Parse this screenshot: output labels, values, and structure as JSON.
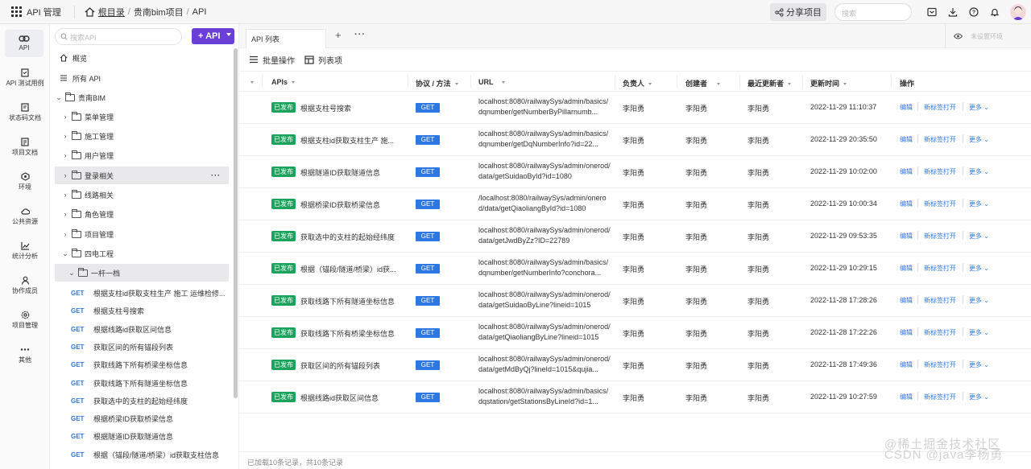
{
  "topbar": {
    "app_label": "API 管理",
    "breadcrumb": {
      "root": "根目录",
      "sep1": "/",
      "project": "贵南bim项目",
      "sep2": "/",
      "current": "API"
    },
    "share_label": "分享项目",
    "search_placeholder": "搜索"
  },
  "left_nav": [
    {
      "label": "API",
      "icon": "link-icon"
    },
    {
      "label": "API 测试用例",
      "icon": "test-case-icon"
    },
    {
      "label": "状态码文档",
      "icon": "status-doc-icon"
    },
    {
      "label": "项目文档",
      "icon": "doc-icon"
    },
    {
      "label": "环境",
      "icon": "environment-icon"
    },
    {
      "label": "公共资源",
      "icon": "resource-icon"
    },
    {
      "label": "统计分析",
      "icon": "chart-icon"
    },
    {
      "label": "协作成员",
      "icon": "members-icon"
    },
    {
      "label": "项目管理",
      "icon": "settings-icon"
    },
    {
      "label": "其他",
      "icon": "more-icon"
    }
  ],
  "tree": {
    "search_placeholder": "搜索API",
    "add_label": "+ API",
    "overview": "概览",
    "all_api": "所有 API",
    "root_folder": "贵南BIM",
    "folders": [
      "菜单管理",
      "施工管理",
      "用户管理",
      "登录相关",
      "线路相关",
      "角色管理",
      "项目管理",
      "四电工程"
    ],
    "subfolder": "一杆一档",
    "items": [
      {
        "method": "GET",
        "name": "根据支柱id获取支柱生产 施工 运维检修..."
      },
      {
        "method": "GET",
        "name": "根据支柱号搜索"
      },
      {
        "method": "GET",
        "name": "根据线路id获取区间信息"
      },
      {
        "method": "GET",
        "name": "获取区间的所有锚段列表"
      },
      {
        "method": "GET",
        "name": "获取线路下所有桥梁坐标信息"
      },
      {
        "method": "GET",
        "name": "获取线路下所有隧道坐标信息"
      },
      {
        "method": "GET",
        "name": "获取选中的支柱的起始经纬度"
      },
      {
        "method": "GET",
        "name": "根据桥梁ID获取桥梁信息"
      },
      {
        "method": "GET",
        "name": "根据隧道ID获取隧道信息"
      },
      {
        "method": "GET",
        "name": "根据（锚段/隧道/桥梁）id获取支柱信息"
      }
    ]
  },
  "main": {
    "tab_label": "API 列表",
    "tab_add": "+",
    "tab_more": "···",
    "env_label": "未设置环境",
    "toolbar": {
      "batch": "批量操作",
      "columns": "列表项"
    },
    "columns": {
      "apis": "APIs",
      "protocol": "协议 / 方法",
      "url": "URL",
      "owner": "负责人",
      "creator": "创建者",
      "updater": "最近更新者",
      "updated": "更新时间",
      "actions": "操作"
    },
    "action_labels": {
      "edit": "编辑",
      "new_tab": "新标签打开",
      "more": "更多"
    },
    "rows": [
      {
        "status": "已发布",
        "name": "根据支柱号搜索",
        "method": "GET",
        "url": "localhost:8080/railwaySys/admin/basics/dqnumber/getNumberByPillarnumb...",
        "owner": "李阳勇",
        "creator": "李阳勇",
        "updater": "李阳勇",
        "updated": "2022-11-29 11:10:37"
      },
      {
        "status": "已发布",
        "name": "根据支柱id获取支柱生产 施...",
        "method": "GET",
        "url": "localhost:8080/railwaySys/admin/basics/dqnumber/getDqNumberInfo?id=22...",
        "owner": "李阳勇",
        "creator": "李阳勇",
        "updater": "李阳勇",
        "updated": "2022-11-29 20:35:50"
      },
      {
        "status": "已发布",
        "name": "根据隧道ID获取隧道信息",
        "method": "GET",
        "url": "localhost:8080/railwaySys/admin/onerod/data/getSuidaoById?id=1080",
        "owner": "李阳勇",
        "creator": "李阳勇",
        "updater": "李阳勇",
        "updated": "2022-11-29 10:02:00"
      },
      {
        "status": "已发布",
        "name": "根据桥梁ID获取桥梁信息",
        "method": "GET",
        "url": "/localhost:8080/railwaySys/admin/onerod/data/getQiaoliangById?id=1080",
        "owner": "李阳勇",
        "creator": "李阳勇",
        "updater": "李阳勇",
        "updated": "2022-11-29 10:00:34"
      },
      {
        "status": "已发布",
        "name": "获取选中的支柱的起始经纬度",
        "method": "GET",
        "url": "localhost:8080/railwaySys/admin/onerod/data/getJwdByZz?ID=22789",
        "owner": "李阳勇",
        "creator": "李阳勇",
        "updater": "李阳勇",
        "updated": "2022-11-29 09:53:35"
      },
      {
        "status": "已发布",
        "name": "根据（锚段/隧道/桥梁）id获...",
        "method": "GET",
        "url": "localhost:8080/railwaySys/admin/basics/dqnumber/getNumberInfo?conchora...",
        "owner": "李阳勇",
        "creator": "李阳勇",
        "updater": "李阳勇",
        "updated": "2022-11-29 10:29:15"
      },
      {
        "status": "已发布",
        "name": "获取线路下所有隧道坐标信息",
        "method": "GET",
        "url": "localhost:8080/railwaySys/admin/onerod/data/getSuidaoByLine?lineid=1015",
        "owner": "李阳勇",
        "creator": "李阳勇",
        "updater": "李阳勇",
        "updated": "2022-11-28 17:28:26"
      },
      {
        "status": "已发布",
        "name": "获取线路下所有桥梁坐标信息",
        "method": "GET",
        "url": "localhost:8080/railwaySys/admin/onerod/data/getQiaoliangByLine?lineid=1015",
        "owner": "李阳勇",
        "creator": "李阳勇",
        "updater": "李阳勇",
        "updated": "2022-11-28 17:22:26"
      },
      {
        "status": "已发布",
        "name": "获取区间的所有锚段列表",
        "method": "GET",
        "url": "localhost:8080/railwaySys/admin/onerod/data/getMdByQj?lineId=1015&qujia...",
        "owner": "李阳勇",
        "creator": "李阳勇",
        "updater": "李阳勇",
        "updated": "2022-11-28 17:49:36"
      },
      {
        "status": "已发布",
        "name": "根据线路id获取区间信息",
        "method": "GET",
        "url": "localhost:8080/railwaySys/admin/basics/dqstation/getStationsByLineId?id=1...",
        "owner": "李阳勇",
        "creator": "李阳勇",
        "updater": "李阳勇",
        "updated": "2022-11-29 10:27:59"
      }
    ],
    "footer": "已加载10条记录，共10条记录"
  },
  "watermark": {
    "line1": "@稀土掘金技术社区",
    "line2": "CSDN @java李杨勇"
  }
}
